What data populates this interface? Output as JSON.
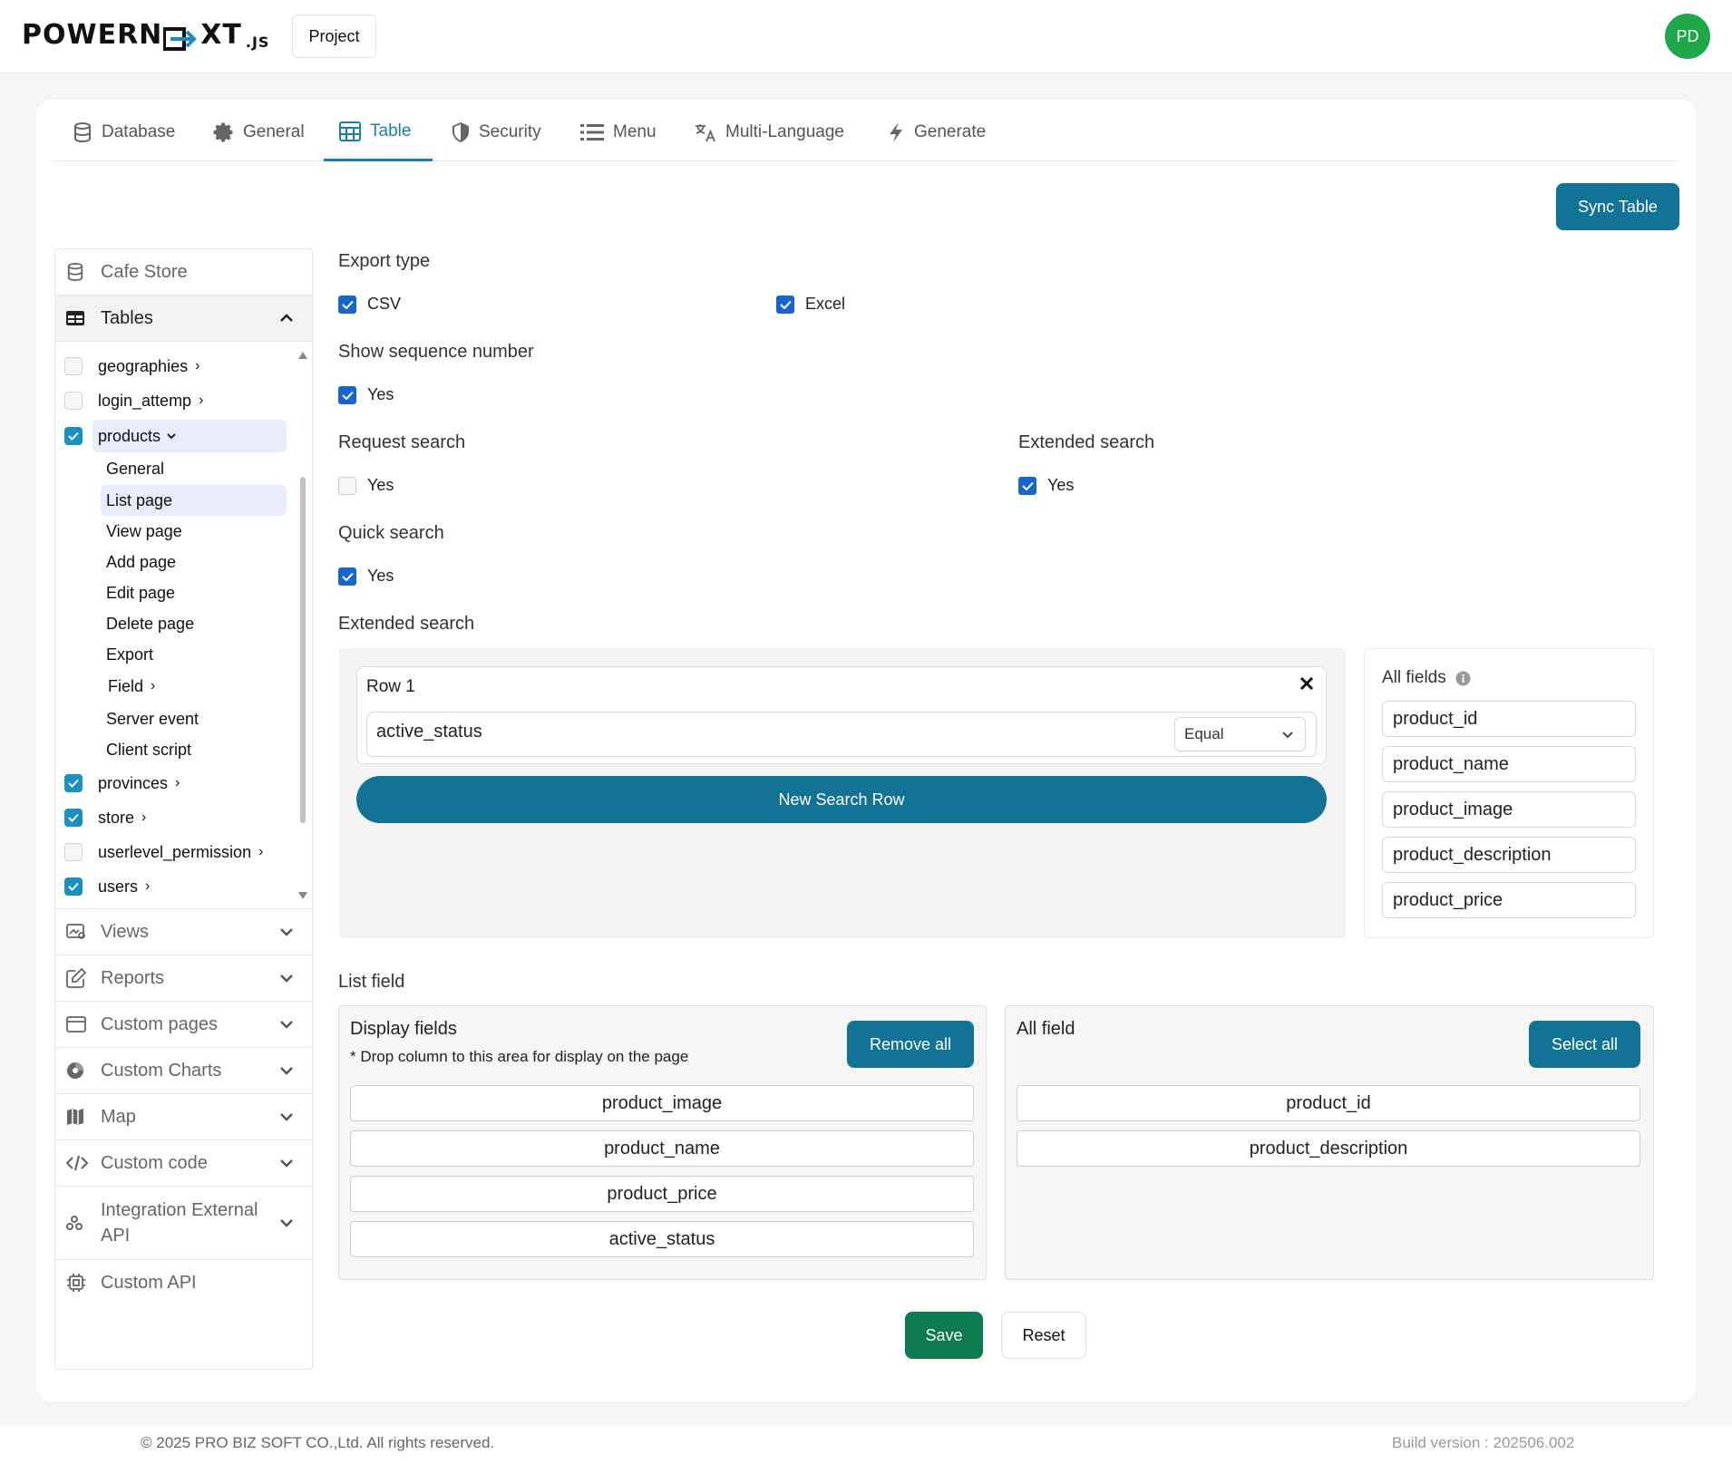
{
  "header": {
    "logo_left": "POWERN",
    "logo_right": "XT",
    "logo_suffix": ".JS",
    "project_label": "Project",
    "avatar_initials": "PD"
  },
  "tabs": [
    {
      "label": "Database",
      "icon": "database-icon"
    },
    {
      "label": "General",
      "icon": "gear-icon"
    },
    {
      "label": "Table",
      "icon": "table-icon",
      "active": true
    },
    {
      "label": "Security",
      "icon": "shield-icon"
    },
    {
      "label": "Menu",
      "icon": "list-icon"
    },
    {
      "label": "Multi-Language",
      "icon": "translate-icon"
    },
    {
      "label": "Generate",
      "icon": "bolt-icon"
    }
  ],
  "sync_label": "Sync Table",
  "sidebar": {
    "project_name": "Cafe Store",
    "tables_header": "Tables",
    "tables": [
      {
        "name": "geographies",
        "checked": false,
        "expanded": false
      },
      {
        "name": "login_attemp",
        "checked": false,
        "expanded": false
      },
      {
        "name": "products",
        "checked": true,
        "expanded": true
      },
      {
        "name": "provinces",
        "checked": true,
        "expanded": false
      },
      {
        "name": "store",
        "checked": true,
        "expanded": false
      },
      {
        "name": "userlevel_permission",
        "checked": false,
        "expanded": false
      },
      {
        "name": "users",
        "checked": true,
        "expanded": false
      }
    ],
    "product_subitems": [
      "General",
      "List page",
      "View page",
      "Add page",
      "Edit page",
      "Delete page",
      "Export",
      "Field",
      "Server event",
      "Client script"
    ],
    "sections": [
      {
        "label": "Views",
        "icon": "views-icon"
      },
      {
        "label": "Reports",
        "icon": "report-icon"
      },
      {
        "label": "Custom pages",
        "icon": "page-icon"
      },
      {
        "label": "Custom Charts",
        "icon": "chart-icon"
      },
      {
        "label": "Map",
        "icon": "map-icon"
      },
      {
        "label": "Custom code",
        "icon": "code-icon"
      },
      {
        "label": "Integration External API",
        "icon": "api-icon"
      }
    ],
    "custom_api": "Custom API"
  },
  "form": {
    "export_type_label": "Export type",
    "csv_label": "CSV",
    "csv_checked": true,
    "excel_label": "Excel",
    "excel_checked": true,
    "seq_label": "Show sequence number",
    "seq_yes": "Yes",
    "seq_checked": true,
    "request_search_label": "Request search",
    "request_yes": "Yes",
    "request_checked": false,
    "extended_search_label": "Extended search",
    "extended_yes": "Yes",
    "extended_checked": true,
    "quick_search_label": "Quick search",
    "quick_yes": "Yes",
    "quick_checked": true,
    "extended_section_label": "Extended search"
  },
  "extended": {
    "row_title": "Row 1",
    "field_value": "active_status",
    "operator": "Equal",
    "new_row_label": "New Search Row",
    "all_fields_label": "All fields",
    "all_fields": [
      "product_id",
      "product_name",
      "product_image",
      "product_description",
      "product_price"
    ]
  },
  "list_field": {
    "label": "List field",
    "display_title": "Display fields",
    "display_hint": "* Drop column to this area for display on the page",
    "remove_all": "Remove all",
    "display_fields": [
      "product_image",
      "product_name",
      "product_price",
      "active_status"
    ],
    "all_title": "All field",
    "select_all": "Select all",
    "all_fields": [
      "product_id",
      "product_description"
    ]
  },
  "actions": {
    "save": "Save",
    "reset": "Reset"
  },
  "footer": {
    "copyright": "© 2025 PRO BIZ SOFT CO.,Ltd. All rights reserved.",
    "build": "Build version : 202506.002"
  },
  "colors": {
    "accent": "#137396",
    "tab_active": "#1a7fa8",
    "save": "#0e7a4f",
    "avatar": "#1fa84a",
    "checkbox": "#1866c9"
  }
}
